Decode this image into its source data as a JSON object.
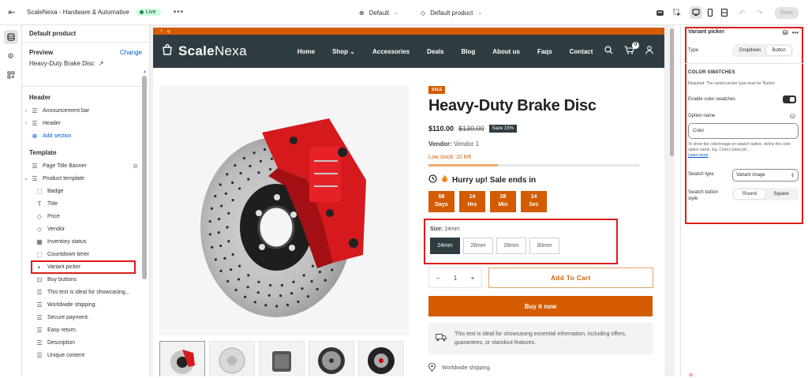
{
  "topbar": {
    "store_name": "ScaleNexa - Hardware & Automative",
    "status": "Live",
    "theme": "Default",
    "template": "Default product",
    "save_label": "Save"
  },
  "left_panel": {
    "title": "Default product",
    "preview_label": "Preview",
    "change_label": "Change",
    "preview_product": "Heavy-Duty Brake Disc",
    "header_section": "Header",
    "header_items": [
      {
        "label": "Announcement bar"
      },
      {
        "label": "Header"
      }
    ],
    "add_section": "Add section",
    "template_section": "Template",
    "template_items": [
      {
        "label": "Page Title Banner"
      },
      {
        "label": "Product template"
      }
    ],
    "blocks": [
      {
        "label": "Badge",
        "icon": "dashed-square-icon"
      },
      {
        "label": "Title",
        "icon": "text-icon"
      },
      {
        "label": "Price",
        "icon": "tag-icon"
      },
      {
        "label": "Vendor",
        "icon": "tag-icon"
      },
      {
        "label": "Inventory status",
        "icon": "building-icon"
      },
      {
        "label": "Countdown timer",
        "icon": "dashed-square-icon"
      },
      {
        "label": "Variant picker",
        "icon": "swatch-icon"
      },
      {
        "label": "Buy buttons",
        "icon": "cart-icon"
      },
      {
        "label": "This text is ideal for showcasing...",
        "icon": "text-lines-icon"
      },
      {
        "label": "Worldwide shipping.",
        "icon": "text-lines-icon"
      },
      {
        "label": "Secure payment.",
        "icon": "text-lines-icon"
      },
      {
        "label": "Easy return.",
        "icon": "text-lines-icon"
      },
      {
        "label": "Description",
        "icon": "text-lines-icon"
      },
      {
        "label": "Unique content",
        "icon": "text-lines-icon"
      }
    ]
  },
  "store": {
    "logo_bold": "Scale",
    "logo_light": "Nexa",
    "menu": [
      "Home",
      "Shop",
      "Accessories",
      "Deals",
      "Blog",
      "About us",
      "Faqs",
      "Contact"
    ],
    "cart_count": "0",
    "product": {
      "badge": "SALE",
      "title": "Heavy-Duty Brake Disc",
      "price": "$110.00",
      "compare_price": "$130.00",
      "save": "Save 15%",
      "vendor_label": "Vendor:",
      "vendor": "Vendor 1",
      "stock": "Low stock: 10 left",
      "stock_fraction": 0.33,
      "hurry": "Hurry up! Sale ends in",
      "countdown": [
        {
          "value": "68",
          "unit": "Days"
        },
        {
          "value": "14",
          "unit": "Hrs"
        },
        {
          "value": "28",
          "unit": "Min"
        },
        {
          "value": "14",
          "unit": "Sec"
        }
      ],
      "size_label": "Size:",
      "size_value": "24mm",
      "sizes": [
        "24mm",
        "26mm",
        "28mm",
        "30mm"
      ],
      "qty": "1",
      "qty_minus": "−",
      "qty_plus": "+",
      "add_to_cart": "Add To Cart",
      "buy_now": "Buy it now",
      "info_text": "This text is ideal for showcasing essential information, including offers, guarantees, or standout features.",
      "shipping": "Worldwide shipping."
    }
  },
  "right_panel": {
    "title": "Variant picker",
    "type_label": "Type",
    "type_options": [
      "Dropdown",
      "Button"
    ],
    "swatches_heading": "COLOR SWATCHES",
    "swatches_note": "Required: The variant picker type must be 'Button'",
    "enable_swatches": "Enable color swatches",
    "option_name_label": "Option name",
    "option_name_value": "Color",
    "option_note": "To show the color/image on swatch button, define the color option name. Eg. Color,Colour,etc.",
    "learn_more": "Learn more",
    "swatch_type_label": "Swatch type",
    "swatch_type_value": "Variant image",
    "swatch_style_label": "Swatch button style",
    "swatch_style_options": [
      "Round",
      "Square"
    ]
  },
  "colors": {
    "accent": "#d35b00",
    "nav_bg": "#2f3d42",
    "highlight": "#e01b1b"
  }
}
